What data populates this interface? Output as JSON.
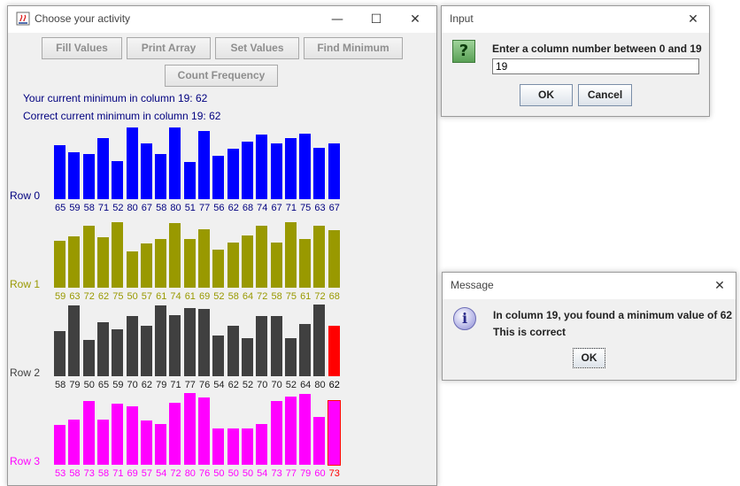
{
  "main_window": {
    "title": "Choose your activity",
    "buttons": {
      "fill_values": "Fill Values",
      "print_array": "Print Array",
      "set_values": "Set Values",
      "find_minimum": "Find Minimum",
      "count_frequency": "Count Frequency"
    },
    "info_line_1": "Your current minimum in column 19: 62",
    "info_line_2": "Correct current minimum in column 19: 62",
    "rows": [
      {
        "label": "Row 0",
        "color": "#0000ff",
        "values": [
          65,
          59,
          58,
          71,
          52,
          80,
          67,
          58,
          80,
          51,
          77,
          56,
          62,
          68,
          74,
          67,
          71,
          75,
          63,
          67
        ]
      },
      {
        "label": "Row 1",
        "color": "#999900",
        "values": [
          59,
          63,
          72,
          62,
          75,
          50,
          57,
          61,
          74,
          61,
          69,
          52,
          58,
          64,
          72,
          58,
          75,
          61,
          72,
          68
        ]
      },
      {
        "label": "Row 2",
        "color": "#404040",
        "values": [
          58,
          79,
          50,
          65,
          59,
          70,
          62,
          79,
          71,
          77,
          76,
          54,
          62,
          52,
          70,
          70,
          52,
          64,
          80,
          62
        ]
      },
      {
        "label": "Row 3",
        "color": "#ff00ff",
        "values": [
          53,
          58,
          73,
          58,
          71,
          69,
          57,
          54,
          72,
          80,
          76,
          50,
          50,
          50,
          54,
          73,
          77,
          79,
          60,
          73
        ]
      }
    ],
    "highlight_color": "#ff0000",
    "highlight_column": 19
  },
  "input_dialog": {
    "title": "Input",
    "prompt": "Enter a column number between 0 and 19",
    "value": "19",
    "ok": "OK",
    "cancel": "Cancel"
  },
  "message_dialog": {
    "title": "Message",
    "line1": "In column 19, you found a minimum value of 62",
    "line2": "This is correct",
    "ok": "OK"
  }
}
